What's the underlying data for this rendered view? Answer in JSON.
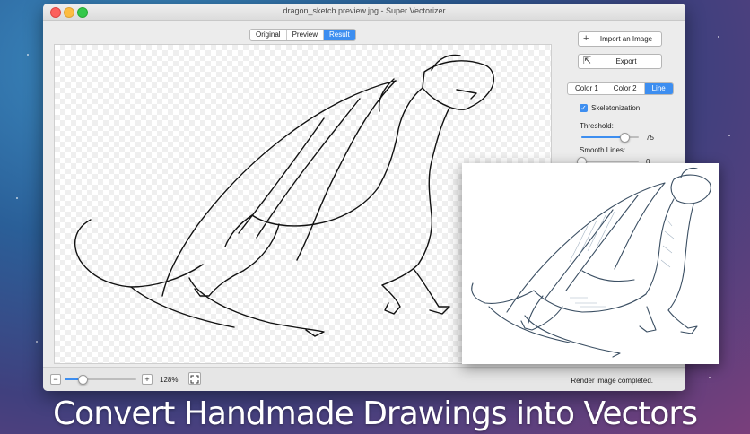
{
  "window": {
    "title": "dragon_sketch.preview.jpg - Super Vectorizer"
  },
  "view_tabs": [
    {
      "label": "Original",
      "active": false
    },
    {
      "label": "Preview",
      "active": false
    },
    {
      "label": "Result",
      "active": true
    }
  ],
  "sidebar": {
    "import_button": {
      "icon": "plus-icon",
      "label": "Import an Image"
    },
    "export_button": {
      "icon": "export-icon",
      "label": "Export"
    },
    "mode_tabs": [
      {
        "label": "Color 1",
        "active": false
      },
      {
        "label": "Color 2",
        "active": false
      },
      {
        "label": "Line",
        "active": true
      }
    ],
    "skeletonization": {
      "label": "Skeletonization",
      "checked": true
    },
    "threshold": {
      "label": "Threshold:",
      "value": "75",
      "level": 0.75
    },
    "smooth_lines": {
      "label": "Smooth Lines:",
      "value": "0",
      "level": 0.0
    }
  },
  "bottom_bar": {
    "zoom_out": "−",
    "zoom_in": "+",
    "zoom_level": "128%",
    "zoom_slider_level": 0.25,
    "status": "Render image completed."
  },
  "headline": "Convert Handmade Drawings into Vectors",
  "colors": {
    "accent": "#3d8ef0",
    "window_bg": "#ececec"
  }
}
